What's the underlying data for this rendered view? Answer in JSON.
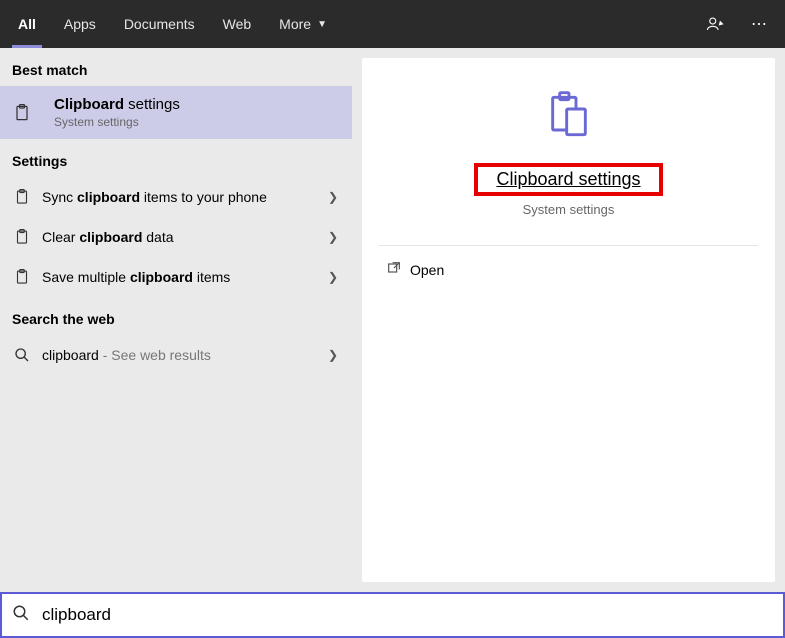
{
  "tabs": {
    "all": "All",
    "apps": "Apps",
    "documents": "Documents",
    "web": "Web",
    "more": "More"
  },
  "left": {
    "best_match_label": "Best match",
    "best_match": {
      "title_prefix": "Clipboard",
      "title_suffix": " settings",
      "sub": "System settings"
    },
    "settings_label": "Settings",
    "rows": {
      "r1_pre": "Sync ",
      "r1_bold": "clipboard",
      "r1_post": " items to your phone",
      "r2_pre": "Clear ",
      "r2_bold": "clipboard",
      "r2_post": " data",
      "r3_pre": "Save multiple ",
      "r3_bold": "clipboard",
      "r3_post": " items"
    },
    "web_label": "Search the web",
    "web_row": {
      "term": "clipboard",
      "hint": " - See web results"
    }
  },
  "preview": {
    "title": "Clipboard settings",
    "sub": "System settings",
    "open": "Open"
  },
  "search": {
    "value": "clipboard"
  }
}
